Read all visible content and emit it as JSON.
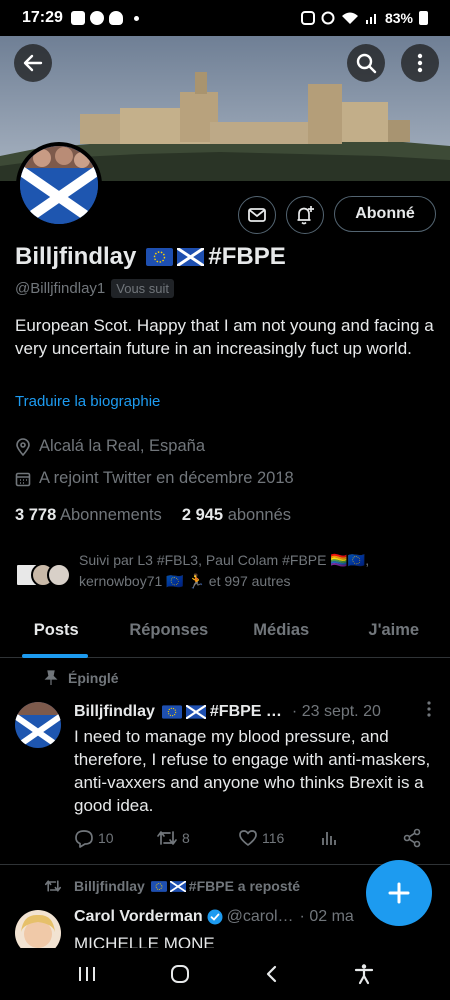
{
  "status_bar": {
    "time": "17:29",
    "battery": "83%"
  },
  "profile": {
    "display_name": "Billjfindlay",
    "name_suffix": "#FBPE",
    "handle": "@Billjfindlay1",
    "follows_you": "Vous suit",
    "follow_button": "Abonné",
    "bio": "European Scot. Happy that I am not young and facing a very uncertain future in an increasingly fuct up world.",
    "translate_label": "Traduire la biographie",
    "location": "Alcalá la Real, España",
    "joined": "A rejoint Twitter en décembre 2018",
    "following_count": "3 778",
    "following_label": "Abonnements",
    "followers_count": "2 945",
    "followers_label": "abonnés",
    "followed_by_text": "Suivi par L3 #FBL3, Paul Colam #FBPE 🏳️‍🌈🇪🇺, kernowboy71 🇪🇺 🏃 et 997 autres"
  },
  "tabs": [
    {
      "label": "Posts",
      "active": true
    },
    {
      "label": "Réponses",
      "active": false
    },
    {
      "label": "Médias",
      "active": false
    },
    {
      "label": "J'aime",
      "active": false
    }
  ],
  "pinned_post": {
    "pinned_label": "Épinglé",
    "author": "Billjfindlay",
    "author_suffix": "#FBPE …",
    "date": "· 23 sept. 20",
    "text": "I need to manage my blood pressure, and therefore, I refuse to engage with anti-maskers, anti-vaxxers and anyone who thinks Brexit is a good idea.",
    "replies": "10",
    "reposts": "8",
    "likes": "116"
  },
  "repost": {
    "repost_label": "Billjfindlay",
    "repost_suffix": "#FBPE a reposté",
    "author": "Carol Vorderman",
    "handle": "@carol…",
    "date": "· 02 ma",
    "text_start": "MICHELLE MONE"
  },
  "colors": {
    "accent": "#1d9bf0",
    "background": "#000000",
    "muted": "#71767b",
    "text": "#e7e9ea"
  },
  "icons": [
    "back-arrow-icon",
    "search-icon",
    "more-vertical-icon",
    "mail-icon",
    "bell-plus-icon",
    "location-pin-icon",
    "calendar-icon",
    "pin-icon",
    "reply-icon",
    "repost-icon",
    "like-icon",
    "stats-icon",
    "share-icon",
    "plus-icon",
    "recents-icon",
    "home-icon",
    "back-icon",
    "accessibility-icon"
  ]
}
